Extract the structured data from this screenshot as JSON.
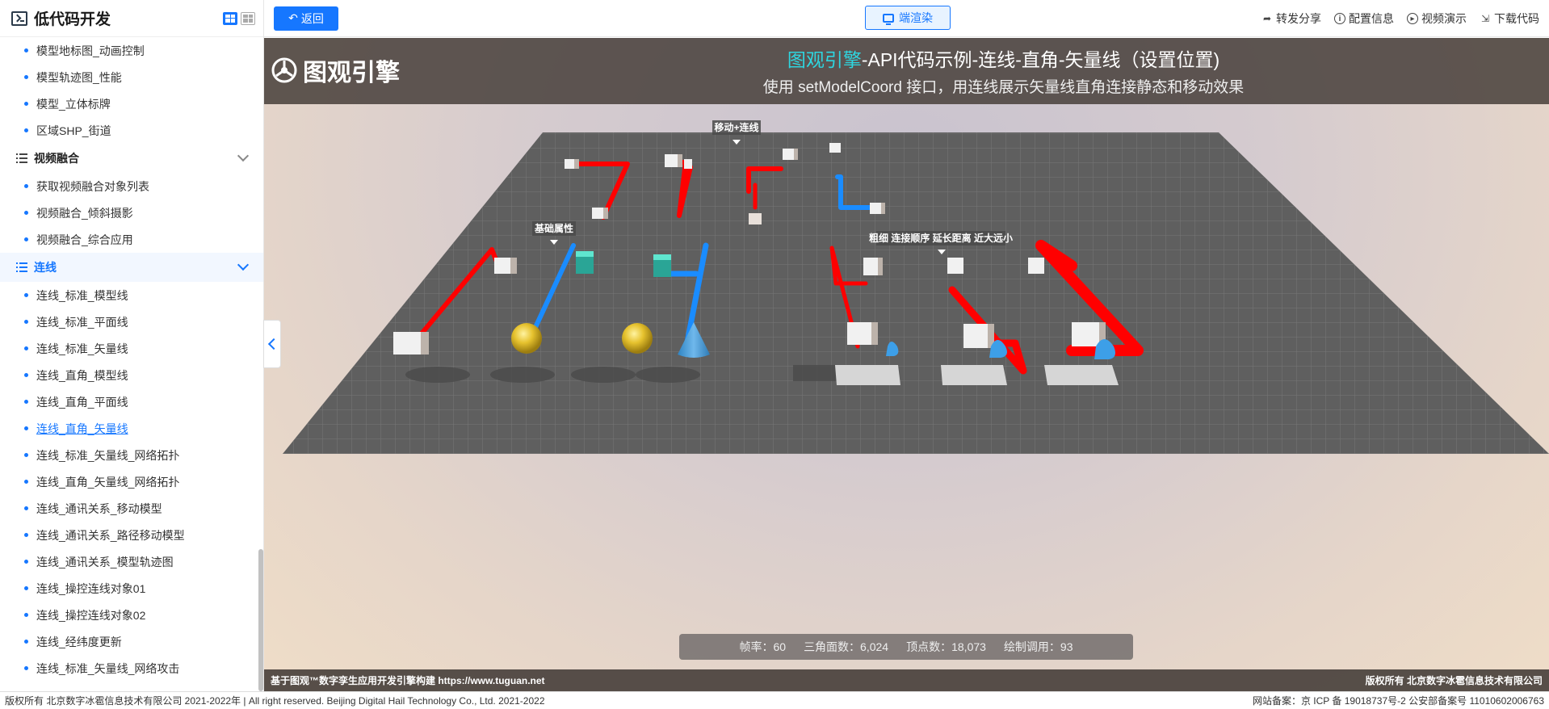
{
  "sidebar": {
    "title": "低代码开发",
    "items_top": [
      "模型地标图_动画控制",
      "模型轨迹图_性能",
      "模型_立体标牌",
      "区域SHP_街道"
    ],
    "group_video": {
      "label": "视频融合",
      "items": [
        "获取视频融合对象列表",
        "视频融合_倾斜摄影",
        "视频融合_综合应用"
      ]
    },
    "group_line": {
      "label": "连线",
      "items": [
        "连线_标准_模型线",
        "连线_标准_平面线",
        "连线_标准_矢量线",
        "连线_直角_模型线",
        "连线_直角_平面线",
        "连线_直角_矢量线",
        "连线_标准_矢量线_网络拓扑",
        "连线_直角_矢量线_网络拓扑",
        "连线_通讯关系_移动模型",
        "连线_通讯关系_路径移动模型",
        "连线_通讯关系_模型轨迹图",
        "连线_操控连线对象01",
        "连线_操控连线对象02",
        "连线_经纬度更新",
        "连线_标准_矢量线_网络攻击"
      ],
      "active_index": 5
    }
  },
  "topbar": {
    "back_label": "返回",
    "render_label": "端渲染",
    "actions": [
      "转发分享",
      "配置信息",
      "视频演示",
      "下载代码"
    ]
  },
  "viewport": {
    "logo_text": "图观引擎",
    "title_brand": "图观引擎",
    "title_rest": "-API代码示例-连线-直角-矢量线（设置位置)",
    "subtitle": "使用 setModelCoord 接口，用连线展示矢量线直角连接静态和移动效果",
    "labels": [
      "移动+连线",
      "基础属性",
      "粗细 连接顺序 延长距离 近大远小"
    ],
    "stats": {
      "fps": "帧率：60",
      "triangles": "三角面数：6,024",
      "vertices": "顶点数：18,073",
      "drawcalls": "绘制调用：93"
    },
    "footer_left": "基于图观™数字孪生应用开发引擎构建 https://www.tuguan.net",
    "footer_right": "版权所有 北京数字冰雹信息技术有限公司"
  },
  "footer": {
    "left": "版权所有 北京数字冰雹信息技术有限公司 2021-2022年 | All right reserved. Beijing Digital Hail Technology Co., Ltd. 2021-2022",
    "right": "网站备案：京 ICP 备 19018737号-2 公安部备案号 11010602006763"
  },
  "colors": {
    "accent": "#1677ff",
    "red_line": "#ff0000",
    "blue_line": "#1a8cff",
    "brand_cyan": "#2ed6e0"
  }
}
